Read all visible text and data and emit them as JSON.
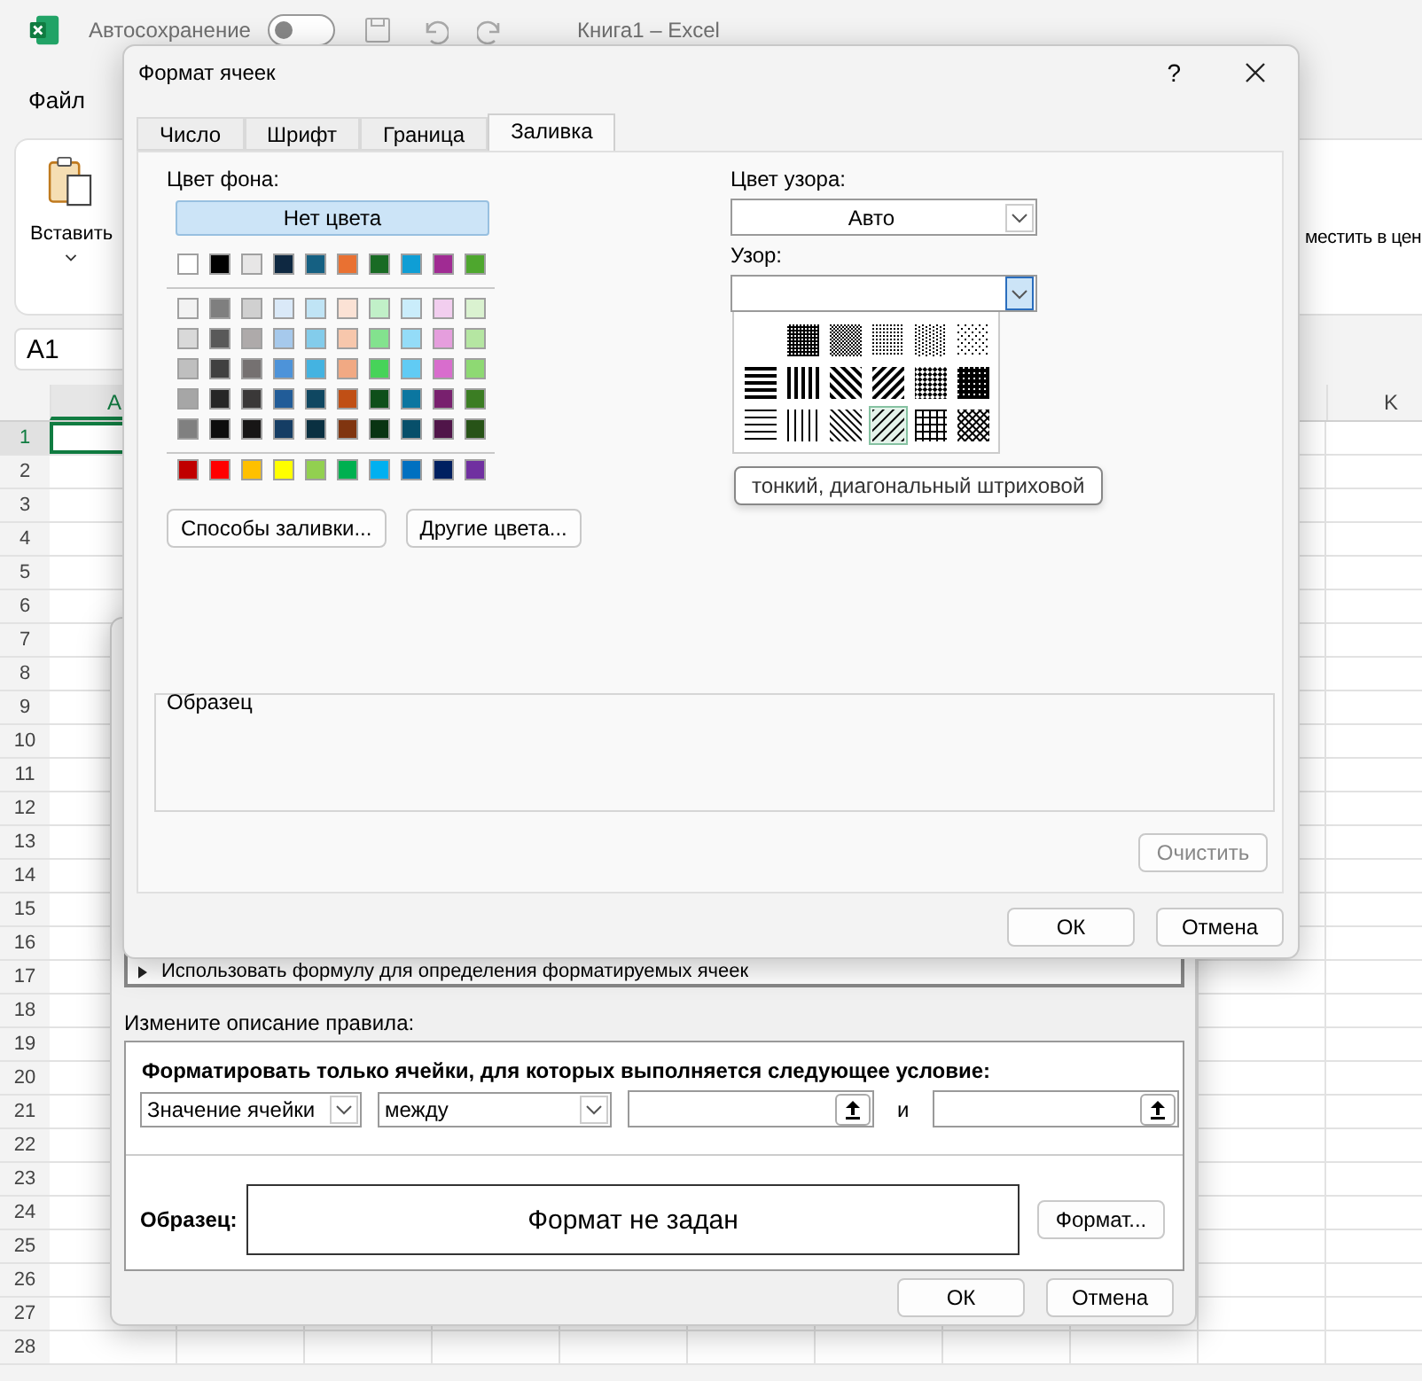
{
  "excel": {
    "autosave": {
      "label": "Автосохранение",
      "on": false
    },
    "title": "Книга1 – Excel",
    "menu": [
      "Файл"
    ],
    "paste_label": "Вставить",
    "merge_label": "местить в цен",
    "name_box": "A1",
    "columns": [
      {
        "label": "A",
        "selected": true
      },
      {
        "label": "K",
        "selected": false
      }
    ],
    "rows": [
      {
        "label": "1",
        "selected": true
      },
      {
        "label": "2",
        "selected": false
      },
      {
        "label": "3",
        "selected": false
      },
      {
        "label": "4",
        "selected": false
      },
      {
        "label": "5",
        "selected": false
      },
      {
        "label": "6",
        "selected": false
      },
      {
        "label": "7",
        "selected": false
      },
      {
        "label": "8",
        "selected": false
      },
      {
        "label": "9",
        "selected": false
      },
      {
        "label": "10",
        "selected": false
      },
      {
        "label": "11",
        "selected": false
      },
      {
        "label": "12",
        "selected": false
      },
      {
        "label": "13",
        "selected": false
      },
      {
        "label": "14",
        "selected": false
      },
      {
        "label": "15",
        "selected": false
      },
      {
        "label": "16",
        "selected": false
      },
      {
        "label": "17",
        "selected": false
      },
      {
        "label": "18",
        "selected": false
      },
      {
        "label": "19",
        "selected": false
      },
      {
        "label": "20",
        "selected": false
      },
      {
        "label": "21",
        "selected": false
      },
      {
        "label": "22",
        "selected": false
      },
      {
        "label": "23",
        "selected": false
      },
      {
        "label": "24",
        "selected": false
      },
      {
        "label": "25",
        "selected": false
      },
      {
        "label": "26",
        "selected": false
      },
      {
        "label": "27",
        "selected": false
      },
      {
        "label": "28",
        "selected": false
      }
    ]
  },
  "rule_dialog": {
    "hidden_option": "Использовать формулу для определения форматируемых ячеек",
    "edit_label": "Измените описание правила:",
    "condition_label": "Форматировать только ячейки, для которых выполняется следующее условие:",
    "field": "Значение ячейки",
    "operator": "между",
    "conjunction": "и",
    "preview_label": "Образец:",
    "preview_text": "Формат не задан",
    "format_button": "Формат...",
    "buttons": [
      "ОК",
      "Отмена"
    ]
  },
  "format_dialog": {
    "title": "Формат ячеек",
    "help": "?",
    "tabs": [
      {
        "label": "Число",
        "selected": false
      },
      {
        "label": "Шрифт",
        "selected": false
      },
      {
        "label": "Граница",
        "selected": false
      },
      {
        "label": "Заливка",
        "selected": true
      }
    ],
    "background": {
      "label": "Цвет фона:",
      "no_color": {
        "label": "Нет цвета",
        "selected": true
      },
      "theme_colors": [
        {
          "color": "#ffffff"
        },
        {
          "color": "#000000"
        },
        {
          "color": "#e7e6e6"
        },
        {
          "color": "#0e2841"
        },
        {
          "color": "#156082"
        },
        {
          "color": "#e97132"
        },
        {
          "color": "#196b24"
        },
        {
          "color": "#0f9ed5"
        },
        {
          "color": "#a02b93"
        },
        {
          "color": "#4ea72e"
        }
      ],
      "tints": [
        [
          {
            "color": "#f2f2f2"
          },
          {
            "color": "#7f7f7f"
          },
          {
            "color": "#d0d0d0"
          },
          {
            "color": "#dae9f8"
          },
          {
            "color": "#c0e4f5"
          },
          {
            "color": "#fbe2d5"
          },
          {
            "color": "#c1f0c8"
          },
          {
            "color": "#caedfb"
          },
          {
            "color": "#f2ceef"
          },
          {
            "color": "#daf2d0"
          }
        ],
        [
          {
            "color": "#d9d9d9"
          },
          {
            "color": "#595959"
          },
          {
            "color": "#aeaaaa"
          },
          {
            "color": "#a6c9ec"
          },
          {
            "color": "#83cceb"
          },
          {
            "color": "#f7c7ac"
          },
          {
            "color": "#83e28e"
          },
          {
            "color": "#94dcf8"
          },
          {
            "color": "#e59edd"
          },
          {
            "color": "#b5e6a2"
          }
        ],
        [
          {
            "color": "#bfbfbf"
          },
          {
            "color": "#404040"
          },
          {
            "color": "#757171"
          },
          {
            "color": "#4d93d9"
          },
          {
            "color": "#44b3e1"
          },
          {
            "color": "#f1a983"
          },
          {
            "color": "#47d359"
          },
          {
            "color": "#61cbf4"
          },
          {
            "color": "#d86dcd"
          },
          {
            "color": "#8ed973"
          }
        ],
        [
          {
            "color": "#a6a6a6"
          },
          {
            "color": "#262626"
          },
          {
            "color": "#3a3838"
          },
          {
            "color": "#215c98"
          },
          {
            "color": "#0f4761"
          },
          {
            "color": "#c04f15"
          },
          {
            "color": "#0e4f1a"
          },
          {
            "color": "#0b76a0"
          },
          {
            "color": "#78206e"
          },
          {
            "color": "#3b7d23"
          }
        ],
        [
          {
            "color": "#808080"
          },
          {
            "color": "#0d0d0d"
          },
          {
            "color": "#171616"
          },
          {
            "color": "#153d64"
          },
          {
            "color": "#0a3041"
          },
          {
            "color": "#803510"
          },
          {
            "color": "#093412"
          },
          {
            "color": "#074f6a"
          },
          {
            "color": "#501549"
          },
          {
            "color": "#275317"
          }
        ]
      ],
      "standard_colors": [
        {
          "color": "#c00000"
        },
        {
          "color": "#ff0000"
        },
        {
          "color": "#ffc000"
        },
        {
          "color": "#ffff00"
        },
        {
          "color": "#92d050"
        },
        {
          "color": "#00b050"
        },
        {
          "color": "#00b0f0"
        },
        {
          "color": "#0070c0"
        },
        {
          "color": "#002060"
        },
        {
          "color": "#7030a0"
        }
      ],
      "buttons": [
        "Способы заливки...",
        "Другие цвета..."
      ]
    },
    "pattern_color": {
      "label": "Цвет узора:",
      "value": "Авто"
    },
    "pattern": {
      "label": "Узор:",
      "tooltip": "тонкий, диагональный штриховой",
      "options": [
        {
          "kind": "none",
          "selected": false
        },
        {
          "kind": "gray75",
          "selected": false
        },
        {
          "kind": "gray50",
          "selected": false
        },
        {
          "kind": "gray25",
          "selected": false
        },
        {
          "kind": "gray12",
          "selected": false
        },
        {
          "kind": "gray6",
          "selected": false
        },
        {
          "kind": "thick_h",
          "selected": false
        },
        {
          "kind": "thick_v",
          "selected": false
        },
        {
          "kind": "thick_rdiag",
          "selected": false
        },
        {
          "kind": "thick_diag",
          "selected": false
        },
        {
          "kind": "thick_dcross",
          "selected": false
        },
        {
          "kind": "thick_cross",
          "selected": false
        },
        {
          "kind": "thin_h",
          "selected": false
        },
        {
          "kind": "thin_v",
          "selected": false
        },
        {
          "kind": "thin_rdiag",
          "selected": false
        },
        {
          "kind": "thin_diag",
          "selected": true
        },
        {
          "kind": "thin_cross",
          "selected": false
        },
        {
          "kind": "thin_dcross",
          "selected": false
        }
      ]
    },
    "sample_label": "Образец",
    "clear_button": {
      "label": "Очистить",
      "disabled": true
    },
    "buttons": [
      "ОК",
      "Отмена"
    ]
  }
}
